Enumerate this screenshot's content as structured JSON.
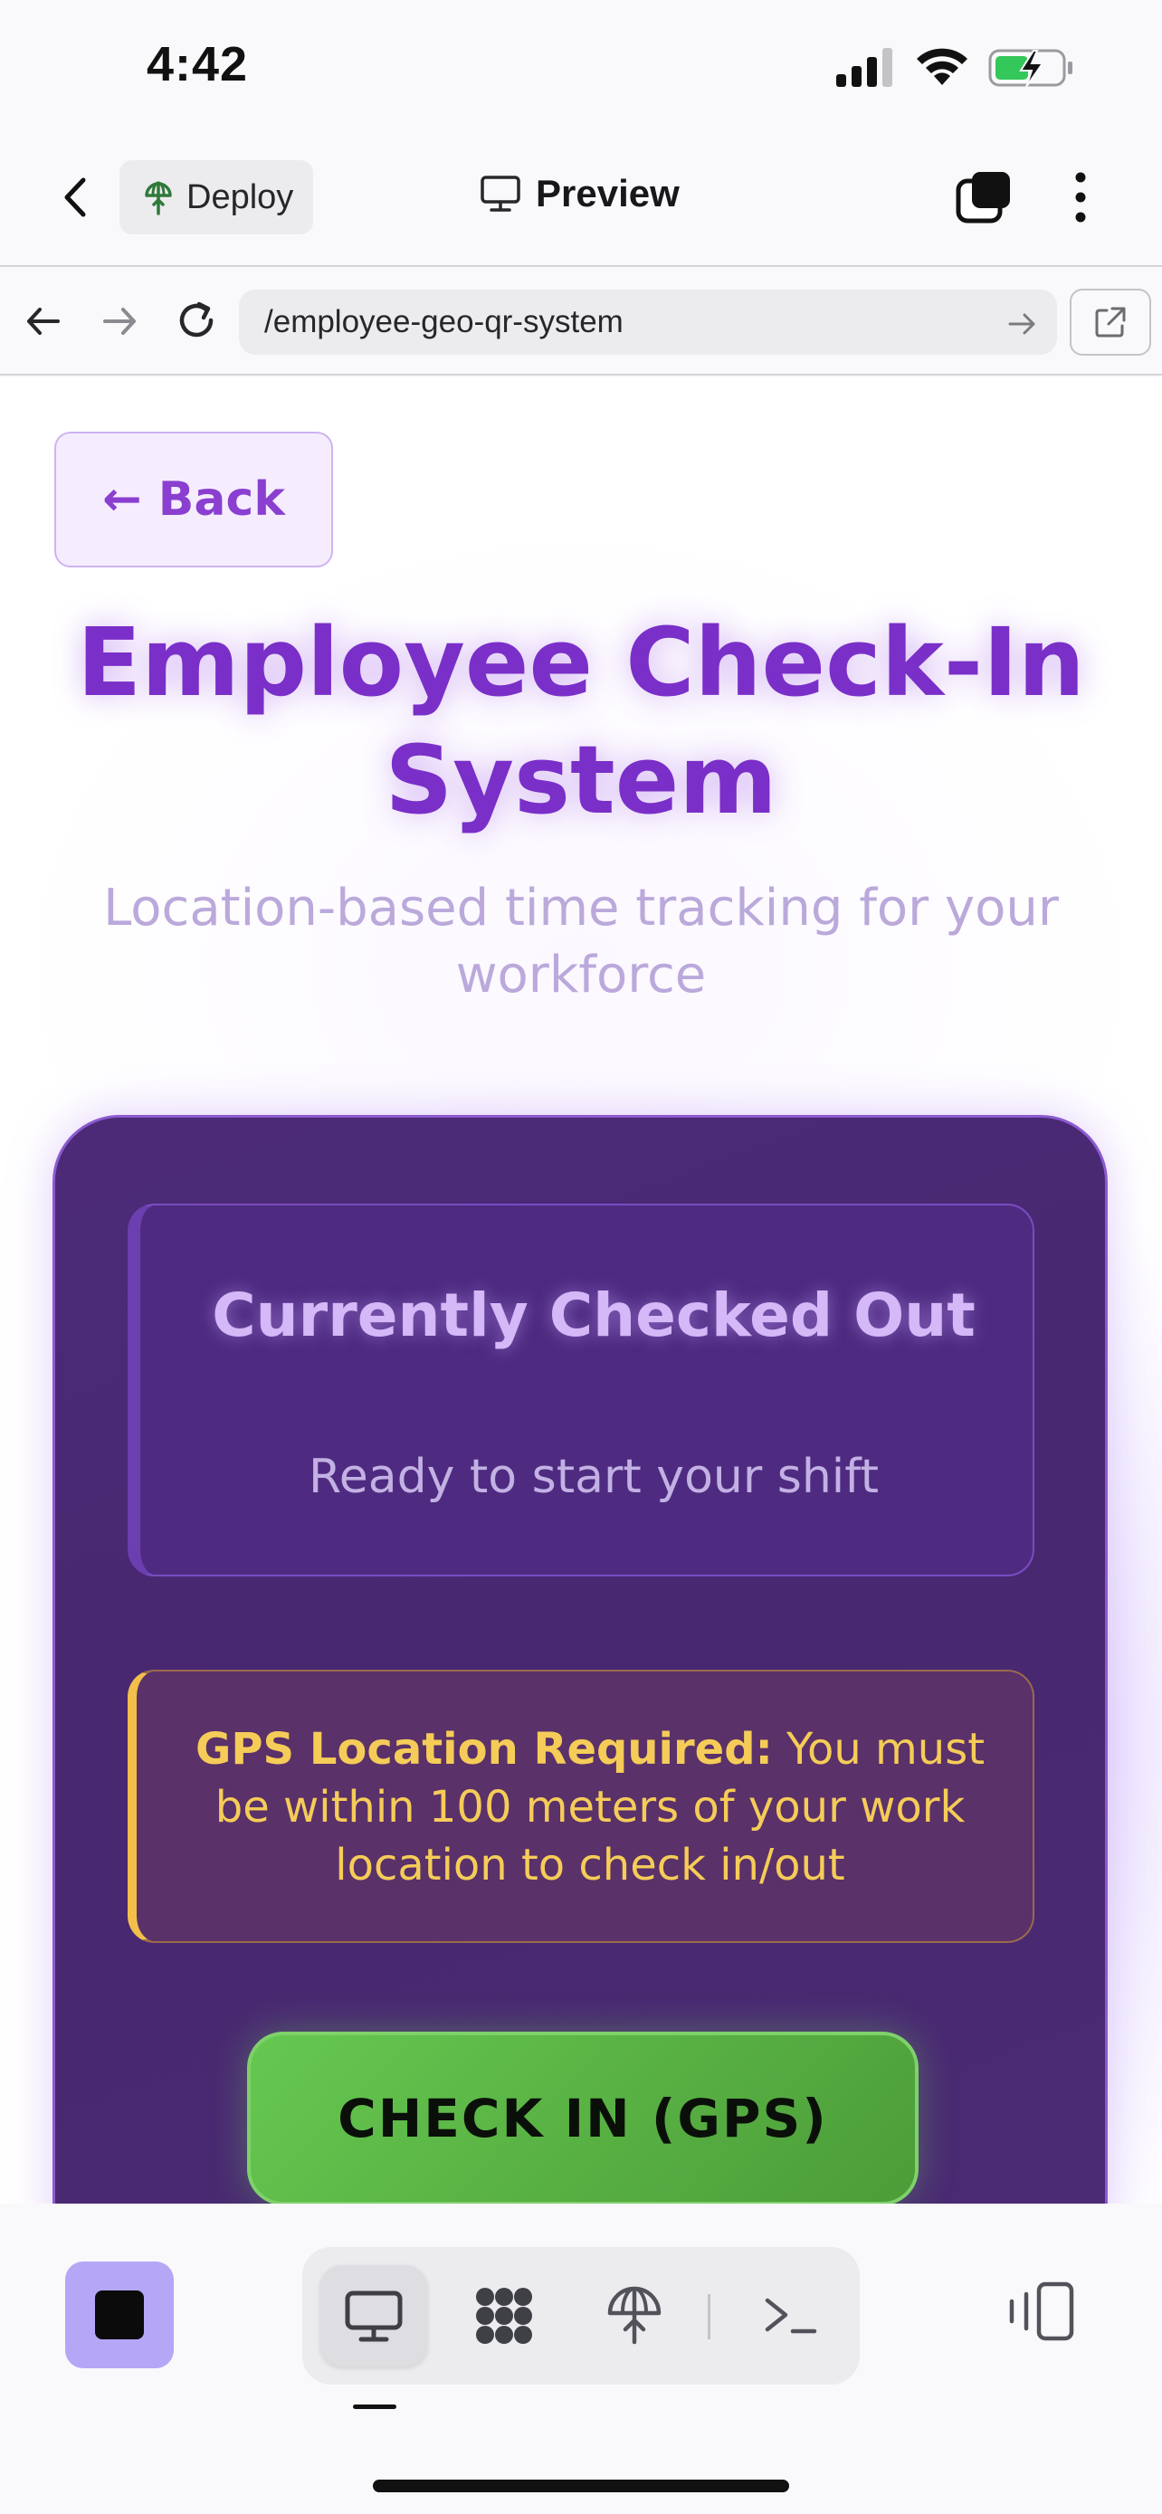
{
  "status_bar": {
    "time": "4:42"
  },
  "header": {
    "deploy_label": "Deploy",
    "preview_label": "Preview"
  },
  "url_bar": {
    "url": "/employee-geo-qr-system"
  },
  "page": {
    "back_label": "← Back",
    "title": "Employee Check-In System",
    "subtitle": "Location-based time tracking for your workforce",
    "status_title": "Currently Checked Out",
    "status_subtitle": "Ready to start your shift",
    "gps_label": "GPS Location Required:",
    "gps_text": " You must be within 100 meters of your work location to check in/out",
    "checkin_label": "CHECK IN (GPS)"
  },
  "colors": {
    "accent_purple": "#7a2fc8",
    "card_bg": "#4a2b74",
    "warning_yellow": "#f2c04a",
    "success_green": "#66c850",
    "stop_button": "#b6a6f6"
  },
  "toolbar": {
    "icons": [
      "stop-icon",
      "monitor-icon",
      "grid-icon",
      "deploy-icon",
      "terminal-icon",
      "device-toggle-icon"
    ],
    "active_mode": "monitor"
  }
}
